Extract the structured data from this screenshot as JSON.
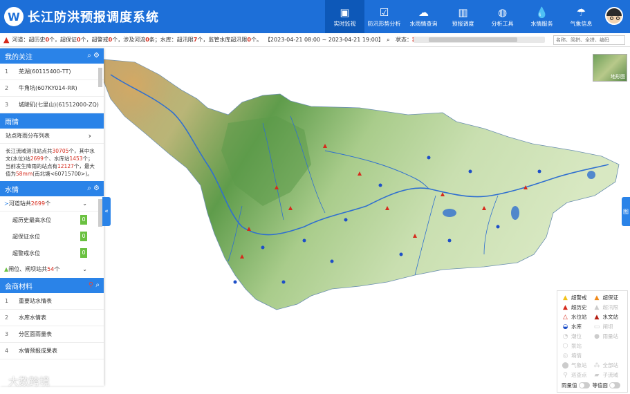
{
  "app": {
    "title": "长江防洪预报调度系统",
    "logo_glyph": "W"
  },
  "nav": [
    {
      "label": "实时监视",
      "icon": "monitor-icon",
      "glyph": "▣",
      "active": true
    },
    {
      "label": "防汛形势分析",
      "icon": "chart-check-icon",
      "glyph": "☑",
      "active": false
    },
    {
      "label": "水雨情查询",
      "icon": "cloud-rain-icon",
      "glyph": "☁",
      "active": false
    },
    {
      "label": "预报调度",
      "icon": "forecast-icon",
      "glyph": "▥",
      "active": false
    },
    {
      "label": "分析工具",
      "icon": "tools-icon",
      "glyph": "◍",
      "active": false
    },
    {
      "label": "水情服务",
      "icon": "water-drop-icon",
      "glyph": "💧",
      "active": false
    },
    {
      "label": "气象信息",
      "icon": "umbrella-icon",
      "glyph": "☂",
      "active": false
    }
  ],
  "alert": {
    "p1": "河道：超历史",
    "v1": "0",
    "p2": "个，超保证",
    "v2": "0",
    "p3": "个，超警戒",
    "v3": "0",
    "p4": "个，涉及河流",
    "v4": "0",
    "p5": "条；水库：超汛限",
    "v5": "7",
    "p6": "个，监管水库超汛限",
    "v6": "0",
    "p7": "个。",
    "range": "【2023-04-21 08:00 ~ 2023-04-21 19:00】",
    "status_label": "状态：",
    "status_value": "实时",
    "search_placeholder": "名称、简拼、全拼、编码"
  },
  "focus": {
    "title": "我的关注",
    "items": [
      {
        "num": "1",
        "label": "芜湖(60115400-TT)"
      },
      {
        "num": "2",
        "label": "牛角坑(607KY014-RR)"
      },
      {
        "num": "3",
        "label": "城陵矶(七里山)(61512000-ZQ)"
      }
    ]
  },
  "rain": {
    "title": "雨情",
    "dist_label": "站点降雨分布列表",
    "t1": "长江流域测汛站点共",
    "total": "30705",
    "t2": "个，其中水文(水位)站",
    "hydro": "2699",
    "t3": "个、水库站",
    "reservoir": "1453",
    "t4": "个；当前发生降雨的站点有",
    "raining": "12127",
    "t5": "个，最大值为",
    "max": "58mm",
    "t6": "(南北塘<60715700>)。"
  },
  "water": {
    "title": "水情",
    "river_label_a": "河道站共",
    "river_count": "2699",
    "river_label_b": "个",
    "rows": [
      {
        "label": "超历史最高水位",
        "value": "0"
      },
      {
        "label": "超保证水位",
        "value": "0"
      },
      {
        "label": "超警戒水位",
        "value": "0"
      }
    ],
    "gate_label_a": "闸位、闸坝站共",
    "gate_count": "54",
    "gate_label_b": "个"
  },
  "meeting": {
    "title": "会商材料",
    "items": [
      {
        "num": "1",
        "label": "重要站水情表"
      },
      {
        "num": "2",
        "label": "水库水情表"
      },
      {
        "num": "3",
        "label": "分区面雨量表"
      },
      {
        "num": "4",
        "label": "水情预报成果表"
      }
    ]
  },
  "map": {
    "thumb_label": "地形图",
    "right_tab": "图"
  },
  "legend": {
    "items": [
      {
        "label": "超警戒",
        "glyph": "▲",
        "color": "#f2c21b",
        "dim": false
      },
      {
        "label": "超保证",
        "glyph": "▲",
        "color": "#f08a1b",
        "dim": false
      },
      {
        "label": "超历史",
        "glyph": "▲",
        "color": "#d62a1c",
        "dim": false
      },
      {
        "label": "超汛限",
        "glyph": "▲",
        "color": "#cccccc",
        "dim": true
      },
      {
        "label": "水位站",
        "glyph": "△",
        "color": "#d62a1c",
        "dim": false
      },
      {
        "label": "水文站",
        "glyph": "▲",
        "color": "#b51d12",
        "dim": false
      },
      {
        "label": "水库",
        "glyph": "◒",
        "color": "#1d4fc8",
        "dim": false
      },
      {
        "label": "闸坝",
        "glyph": "▭",
        "color": "#cccccc",
        "dim": true
      },
      {
        "label": "潮位",
        "glyph": "◔",
        "color": "#cccccc",
        "dim": true
      },
      {
        "label": "雨量站",
        "glyph": "●",
        "color": "#cccccc",
        "dim": true
      },
      {
        "label": "泵站",
        "glyph": "⬡",
        "color": "#cccccc",
        "dim": true
      },
      {
        "label": "",
        "glyph": "",
        "color": "#cccccc",
        "dim": true
      },
      {
        "label": "墒情",
        "glyph": "◎",
        "color": "#cccccc",
        "dim": true
      },
      {
        "label": "",
        "glyph": "",
        "color": "#cccccc",
        "dim": true
      },
      {
        "label": "气象站",
        "glyph": "⬤",
        "color": "#cccccc",
        "dim": true
      },
      {
        "label": "全部站",
        "glyph": "⁂",
        "color": "#cccccc",
        "dim": true
      },
      {
        "label": "巡查点",
        "glyph": "⚲",
        "color": "#cccccc",
        "dim": true
      },
      {
        "label": "子流域",
        "glyph": "▰",
        "color": "#cccccc",
        "dim": true
      }
    ],
    "toggle1": "雨量值",
    "toggle2": "等值面"
  },
  "watermark": "大数跨境"
}
